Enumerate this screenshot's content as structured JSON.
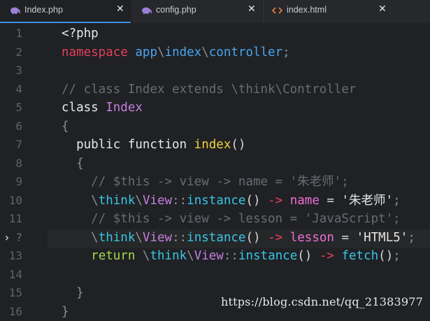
{
  "tabs": [
    {
      "label": "Index.php",
      "icon": "php-elephant-icon",
      "close": "✕",
      "active": true
    },
    {
      "label": "config.php",
      "icon": "php-elephant-icon",
      "close": "✕",
      "active": false
    },
    {
      "label": "index.html",
      "icon": "html-tag-icon",
      "close": "✕",
      "active": false
    }
  ],
  "gutter": {
    "line_numbers": [
      "1",
      "2",
      "3",
      "4",
      "5",
      "6",
      "7",
      "8",
      "9",
      "10",
      "11",
      "12",
      "13",
      "14",
      "15",
      "16"
    ],
    "current_line_marker": "?"
  },
  "code": {
    "l1": "<?php",
    "l2_kw": "namespace",
    "l2_a": "app",
    "l2_s1": "\\",
    "l2_b": "index",
    "l2_s2": "\\",
    "l2_c": "controller",
    "l2_end": ";",
    "l4": "// class Index extends \\think\\Controller",
    "l5_kw": "class",
    "l5_name": "Index",
    "l6": "{",
    "l7_kw": "public function",
    "l7_name": "index",
    "l7_paren": "()",
    "l8": "{",
    "l9": "// $this -> view -> name = '朱老师';",
    "l10_a": "\\",
    "l10_b": "think",
    "l10_c": "\\",
    "l10_d": "View",
    "l10_e": "::",
    "l10_f": "instance",
    "l10_g": "()",
    "l10_h": "->",
    "l10_i": "name",
    "l10_j": "=",
    "l10_k": "'朱老师'",
    "l10_l": ";",
    "l11": "// $this -> view -> lesson = 'JavaScript';",
    "l12_a": "\\",
    "l12_b": "think",
    "l12_c": "\\",
    "l12_d": "View",
    "l12_e": "::",
    "l12_f": "instance",
    "l12_g": "()",
    "l12_h": "->",
    "l12_i": "lesson",
    "l12_j": "=",
    "l12_k": "'HTML5'",
    "l12_l": ";",
    "l13_kw": "return",
    "l13_a": "\\",
    "l13_b": "think",
    "l13_c": "\\",
    "l13_d": "View",
    "l13_e": "::",
    "l13_f": "instance",
    "l13_g": "()",
    "l13_h": "->",
    "l13_i": "fetch",
    "l13_j": "()",
    "l13_k": ";",
    "l15": "}",
    "l16": "}"
  },
  "watermark": "https://blog.csdn.net/qq_21383977",
  "colors": {
    "accent": "#3d8be6",
    "background": "#1f2124"
  }
}
